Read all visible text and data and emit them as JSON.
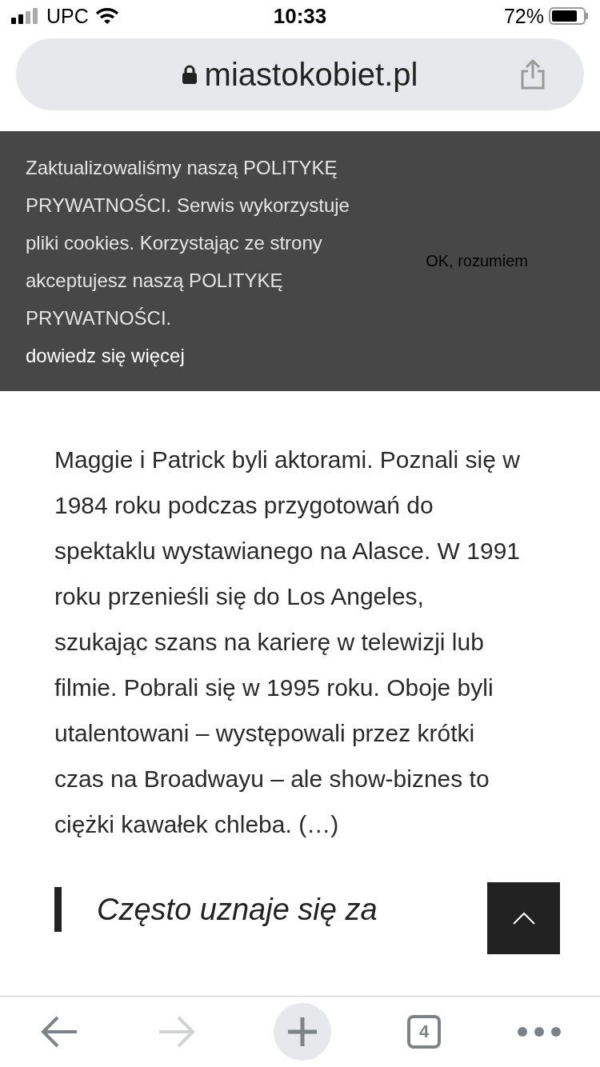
{
  "status_bar": {
    "carrier": "UPC",
    "time": "10:33",
    "battery": "72%"
  },
  "address_bar": {
    "url": "miastokobiet.pl"
  },
  "article": {
    "paragraph": "Maggie i Patrick byli aktorami. Poznali się w 1984 roku podczas przygotowań do spektaklu wystawianego na Alasce. W 1991 roku przenieśli się do Los Angeles, szukając szans na karierę w telewizji lub filmie. Pobrali się w 1995 roku. Oboje byli utalentowani – występowali przez krótki czas na Broadwayu – ale show-biznes to ciężki kawałek chleba. (…)",
    "quote": "Często uznaje się za"
  },
  "cookie_banner": {
    "text": "Zaktualizowaliśmy naszą POLITYKĘ PRYWATNOŚCI. Serwis wykorzystuje pliki cookies. Korzystając ze strony akceptujesz naszą POLITYKĘ PRYWATNOŚCI.",
    "link": "dowiedz się więcej",
    "button": "OK, rozumiem"
  },
  "toolbar": {
    "back_disabled": false,
    "forward_disabled": true,
    "tab_count": "4"
  }
}
